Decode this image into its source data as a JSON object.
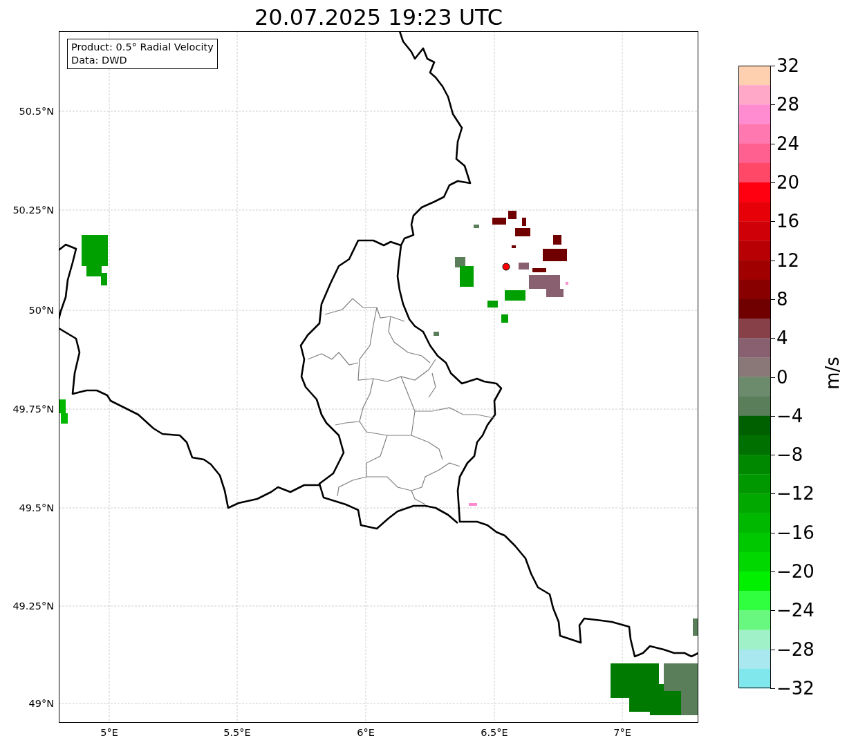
{
  "title": "20.07.2025 19:23 UTC",
  "legend": {
    "lines": [
      "Product: 0.5° Radial Velocity",
      "Data: DWD"
    ]
  },
  "map": {
    "lat_labels": [
      "50.5°N",
      "50.25°N",
      "50°N",
      "49.75°N",
      "49.5°N",
      "49.25°N",
      "49°N"
    ],
    "lon_labels": [
      "5°E",
      "5.5°E",
      "6°E",
      "6.5°E",
      "7°E"
    ]
  },
  "colorbar": {
    "label": "m/s",
    "ticks": [
      "32",
      "28",
      "24",
      "20",
      "16",
      "12",
      "8",
      "4",
      "0",
      "−4",
      "−8",
      "−12",
      "−16",
      "−20",
      "−24",
      "−28",
      "−32"
    ],
    "bands": [
      {
        "color": "#ffd0b0"
      },
      {
        "color": "#ffa8c8"
      },
      {
        "color": "#ff8cd0"
      },
      {
        "color": "#ff78b0"
      },
      {
        "color": "#ff6090"
      },
      {
        "color": "#ff4868"
      },
      {
        "color": "#ff0010"
      },
      {
        "color": "#e80008"
      },
      {
        "color": "#d00008"
      },
      {
        "color": "#b80004"
      },
      {
        "color": "#a00000"
      },
      {
        "color": "#880000"
      },
      {
        "color": "#700000"
      },
      {
        "color": "#884048"
      },
      {
        "color": "#886070"
      },
      {
        "color": "#8a7878"
      },
      {
        "color": "#6c8a6c"
      },
      {
        "color": "#5a7e5a"
      },
      {
        "color": "#006000"
      },
      {
        "color": "#007000"
      },
      {
        "color": "#008800"
      },
      {
        "color": "#009800"
      },
      {
        "color": "#00a800"
      },
      {
        "color": "#00b800"
      },
      {
        "color": "#00c800"
      },
      {
        "color": "#00d800"
      },
      {
        "color": "#00f000"
      },
      {
        "color": "#30ff40"
      },
      {
        "color": "#68f880"
      },
      {
        "color": "#a0f0c8"
      },
      {
        "color": "#a8e8ee"
      },
      {
        "color": "#80e8ec"
      }
    ]
  }
}
